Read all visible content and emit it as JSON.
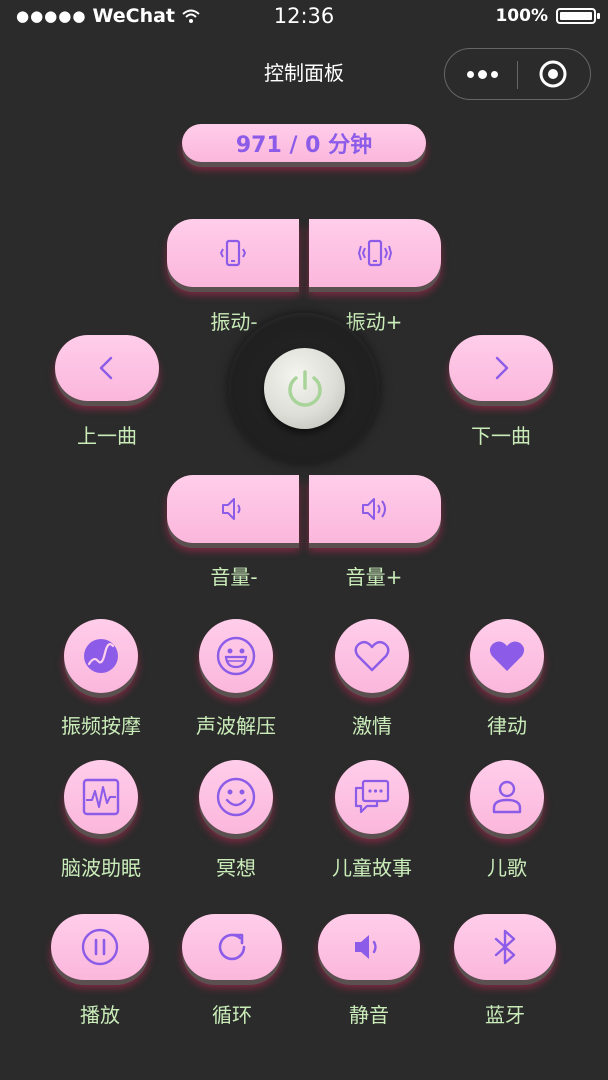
{
  "status_bar": {
    "carrier": "WeChat",
    "time": "12:36",
    "battery_percent": "100%",
    "battery_level": 1.0
  },
  "nav": {
    "title": "控制面板"
  },
  "counter": {
    "text": "971 / 0 分钟"
  },
  "vibration": {
    "minus_label": "振动-",
    "plus_label": "振动+"
  },
  "track": {
    "prev_label": "上一曲",
    "next_label": "下一曲"
  },
  "volume": {
    "minus_label": "音量-",
    "plus_label": "音量+"
  },
  "modes_row1": [
    {
      "label": "振频按摩",
      "icon": "massage-icon"
    },
    {
      "label": "声波解压",
      "icon": "smile-grin-icon"
    },
    {
      "label": "激情",
      "icon": "heart-outline-icon"
    },
    {
      "label": "律动",
      "icon": "heart-filled-icon"
    }
  ],
  "modes_row2": [
    {
      "label": "脑波助眠",
      "icon": "waveform-icon"
    },
    {
      "label": "冥想",
      "icon": "smile-icon"
    },
    {
      "label": "儿童故事",
      "icon": "chat-bubble-icon"
    },
    {
      "label": "儿歌",
      "icon": "user-icon"
    }
  ],
  "controls": [
    {
      "label": "播放",
      "icon": "pause-icon"
    },
    {
      "label": "循环",
      "icon": "loop-icon"
    },
    {
      "label": "静音",
      "icon": "speaker-icon"
    },
    {
      "label": "蓝牙",
      "icon": "bluetooth-icon"
    }
  ],
  "colors": {
    "background": "#2b2b2b",
    "button_pink": "#fbb7dc",
    "icon_purple": "#8c5ce8",
    "label_green": "#c9ecb9"
  }
}
